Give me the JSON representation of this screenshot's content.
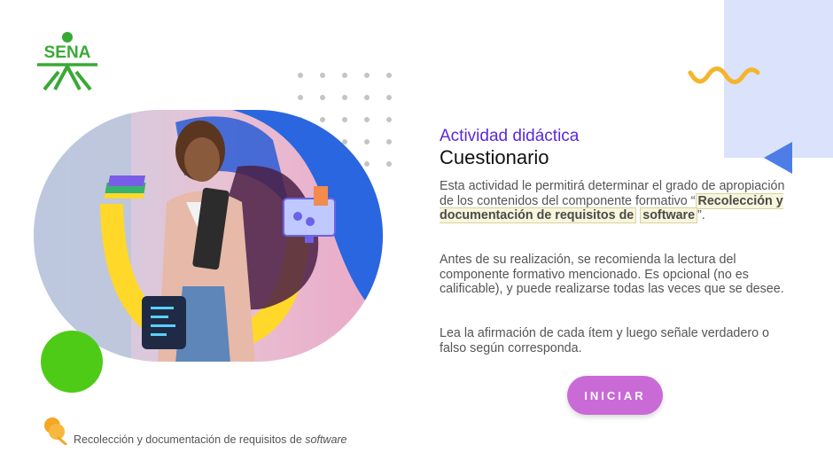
{
  "activity": {
    "subtitle": "Actividad didáctica",
    "title": "Cuestionario",
    "intro_before": "Esta actividad le permitirá determinar el grado de apropiación de los contenidos del componente formativo “",
    "component_name_part1": "Recolección y documentación de requisitos de",
    "component_name_part2": "software",
    "intro_after": "”.",
    "paragraph2": "Antes de su realización, se recomienda la lectura del componente formativo mencionado. Es opcional (no es calificable), y puede realizarse todas las veces que se desee.",
    "paragraph3": "Lea la afirmación de cada ítem y luego señale verdadero o falso según corresponda."
  },
  "start_button": {
    "label": "INICIAR"
  },
  "logo": {
    "text": "SENA"
  },
  "footer": {
    "text": "Recolección y documentación de requisitos de ",
    "emphasis": "software"
  },
  "colors": {
    "accent_purple": "#5b26e0",
    "button": "#c96ad6",
    "logo_green": "#39a935",
    "circle_green": "#4ecb17",
    "panel_blue": "#dae3fb",
    "triangle_blue": "#4d7ee8",
    "wave_yellow": "#f5b52a"
  }
}
